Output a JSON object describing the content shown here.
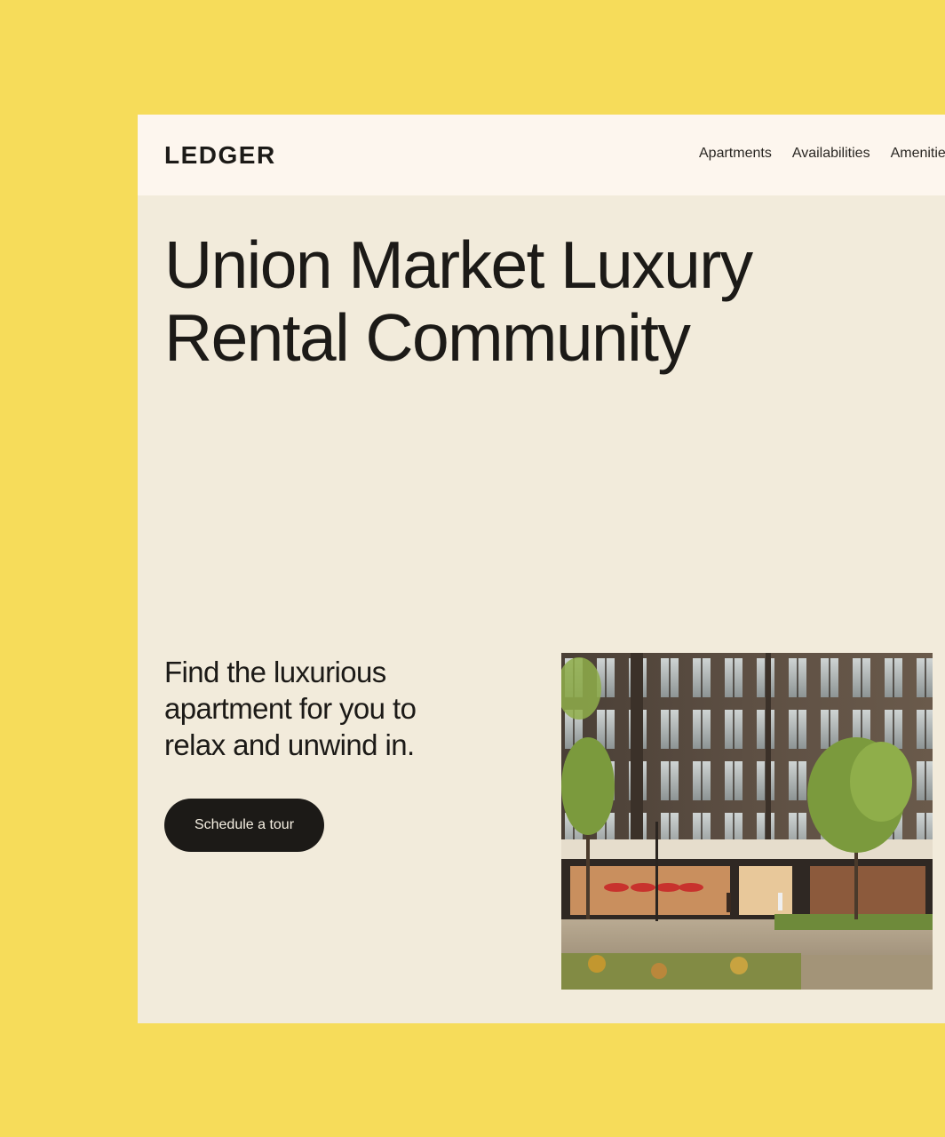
{
  "header": {
    "logo": "LEDGER",
    "nav": [
      {
        "label": "Apartments"
      },
      {
        "label": "Availabilities"
      },
      {
        "label": "Amenities"
      }
    ]
  },
  "hero": {
    "title_line1": "Union Market Luxury",
    "title_line2": "Rental Community",
    "subtitle": "Find the luxurious apartment for you to relax and unwind in.",
    "cta_label": "Schedule a tour"
  },
  "colors": {
    "page_background": "#F6DC5A",
    "site_background": "#F2EBDB",
    "header_background": "#FDF6EE",
    "button_background": "#1C1A17",
    "text": "#1C1A17"
  },
  "icons": {
    "hero_image": "apartment-building-photo"
  }
}
